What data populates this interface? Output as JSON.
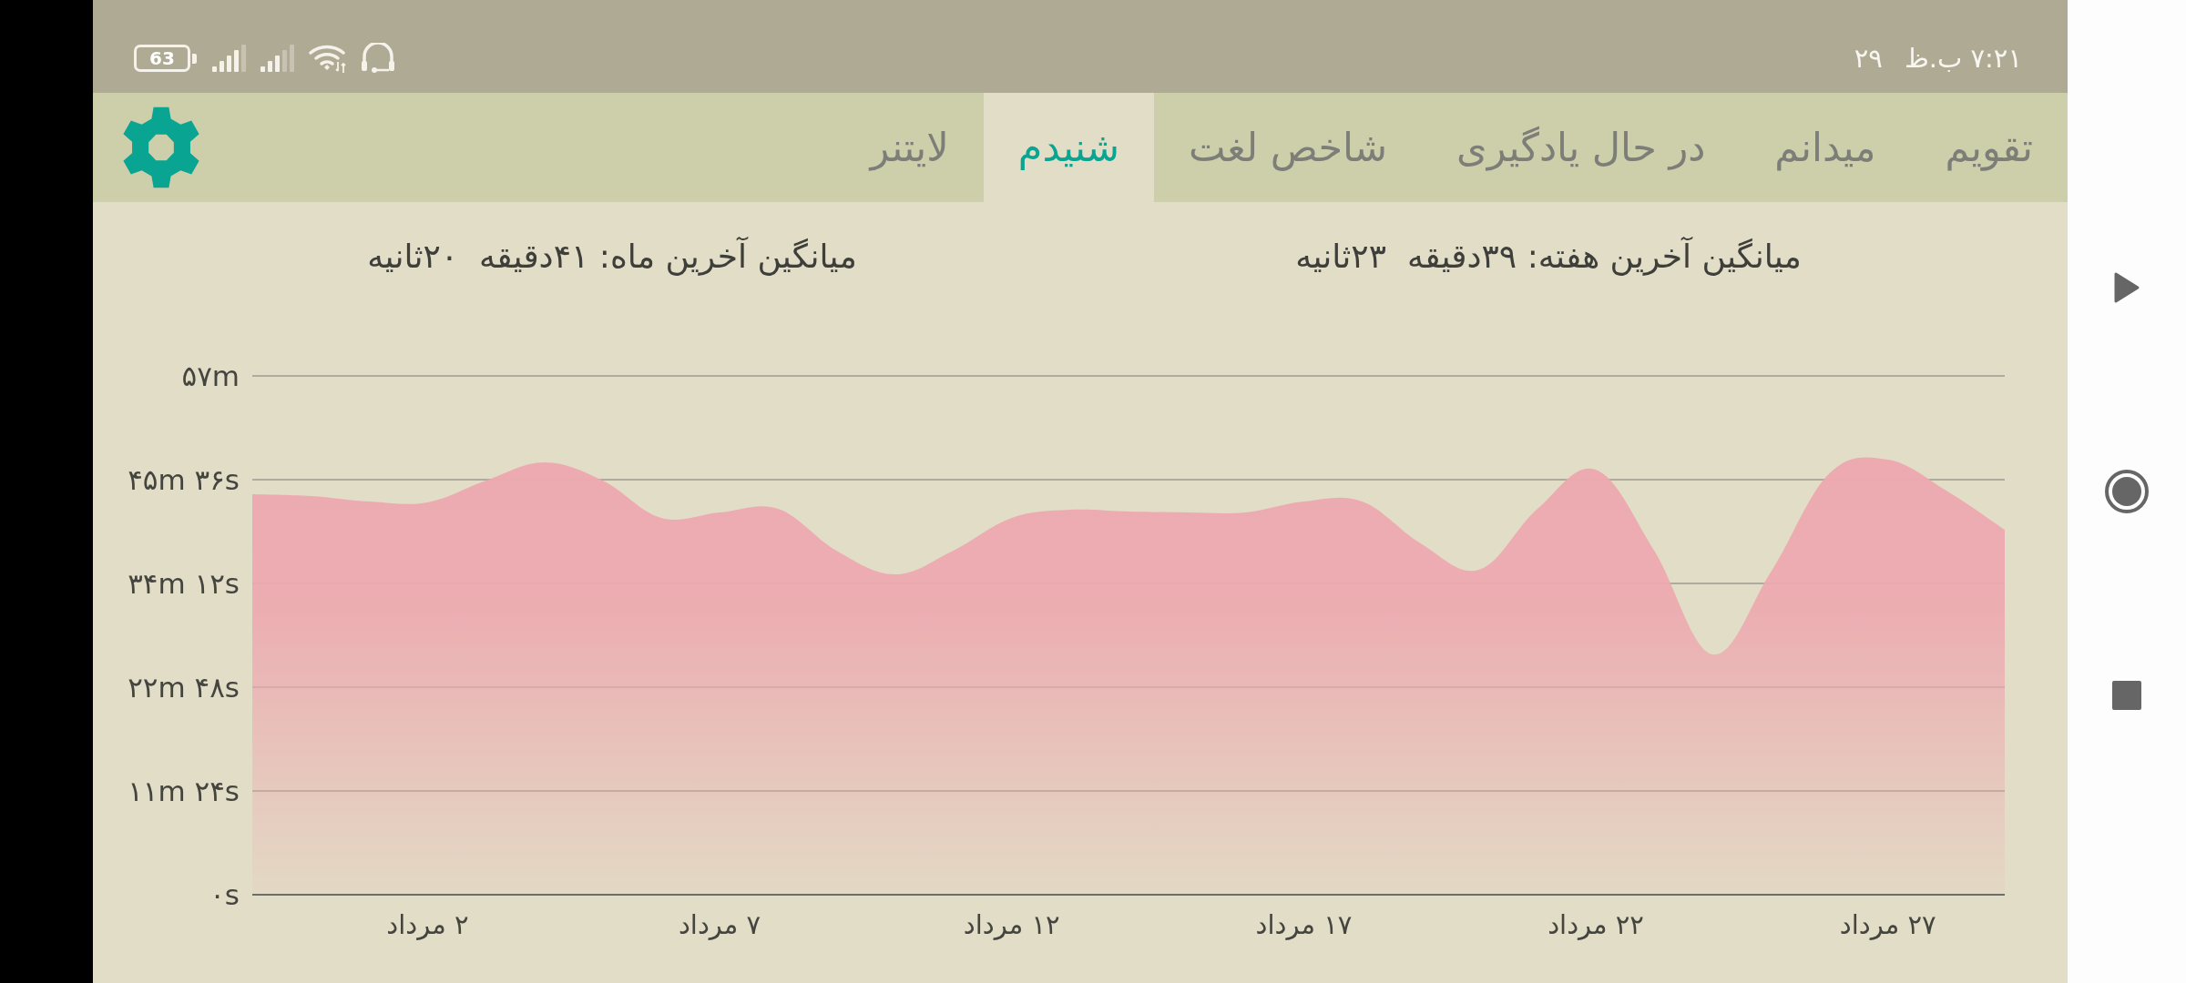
{
  "status_bar": {
    "battery": "63",
    "time": "۷:۲۱ ب.ظ",
    "day": "۲۹"
  },
  "tabs": [
    {
      "label": "تقویم",
      "selected": false
    },
    {
      "label": "میدانم",
      "selected": false
    },
    {
      "label": "در حال یادگیری",
      "selected": false
    },
    {
      "label": "شاخص لغت",
      "selected": false
    },
    {
      "label": "شنیدم",
      "selected": true
    },
    {
      "label": "لایتنر",
      "selected": false
    }
  ],
  "averages": [
    "میانگین آخرین هفته: ۳۹دقیقه  ۲۳ثانیه",
    "میانگین آخرین ماه: ۴۱دقیقه  ۲۰ثانیه"
  ],
  "chart_data": {
    "type": "area",
    "grid": true,
    "categories": [
      null,
      null,
      null,
      "۲ مرداد",
      null,
      null,
      null,
      null,
      "۷ مرداد",
      null,
      null,
      null,
      null,
      "۱۲ مرداد",
      null,
      null,
      null,
      null,
      "۱۷ مرداد",
      null,
      null,
      null,
      null,
      "۲۲ مرداد",
      null,
      null,
      null,
      null,
      "۲۷ مرداد",
      null,
      null
    ],
    "ylim": [
      0,
      57
    ],
    "yticks": [
      {
        "value": 0,
        "label": "۰s"
      },
      {
        "value": 11.4,
        "label": "۱۱m ۲۴s"
      },
      {
        "value": 22.8,
        "label": "۲۲m ۴۸s"
      },
      {
        "value": 34.2,
        "label": "۳۴m ۱۲s"
      },
      {
        "value": 45.6,
        "label": "۴۵m ۳۶s"
      },
      {
        "value": 57,
        "label": "۵۷m"
      }
    ],
    "series": [
      {
        "color": "#eda9b0",
        "values": [
          44.0,
          43.8,
          43.2,
          43.1,
          45.5,
          47.5,
          45.5,
          41.4,
          42.0,
          42.4,
          37.8,
          35.2,
          37.8,
          41.4,
          42.3,
          42.1,
          42.0,
          42.0,
          43.2,
          43.2,
          38.6,
          35.7,
          42.4,
          46.7,
          37.8,
          26.4,
          35.5,
          46.3,
          47.8,
          44.4,
          40.1
        ]
      }
    ]
  }
}
